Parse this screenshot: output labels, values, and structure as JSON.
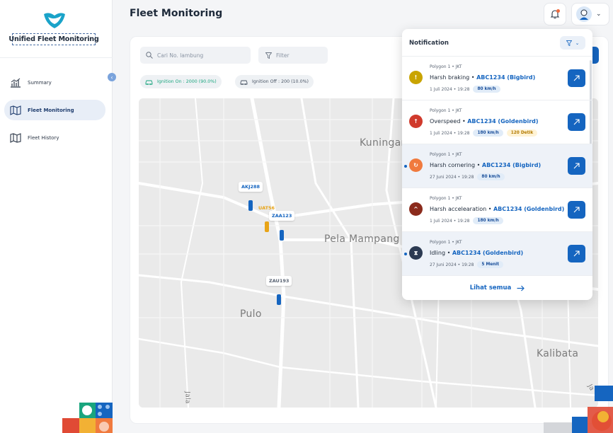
{
  "app": {
    "brand": "Unified Fleet Monitoring"
  },
  "sidebar": {
    "items": [
      {
        "label": "Summary",
        "icon": "chart-bar-icon",
        "active": false
      },
      {
        "label": "Fleet Monitoring",
        "icon": "map-icon",
        "active": true
      },
      {
        "label": "Fleet History",
        "icon": "map-icon",
        "active": false
      }
    ]
  },
  "header": {
    "title": "Fleet Monitoring"
  },
  "toolbar": {
    "search_placeholder": "Cari No. lambung",
    "filter_label": "Filter"
  },
  "status": {
    "ignition_on": "Ignition On : 2000 (90.0%)",
    "ignition_off": "Ignition Off : 200 (10.0%)"
  },
  "map": {
    "places": [
      "Kuningan",
      "Pela Mampang",
      "Pulo",
      "Kalibata",
      "Jala",
      "Ja"
    ],
    "vehicles": [
      {
        "plate": "AKJ288",
        "color": "#1565c0"
      },
      {
        "plate": "UAT56",
        "color": "#e8a417"
      },
      {
        "plate": "ZAA123",
        "color": "#1565c0"
      },
      {
        "plate": "ZAU193",
        "color": "#5a6473"
      }
    ]
  },
  "notifications": {
    "title": "Notification",
    "see_all": "Lihat semua",
    "items": [
      {
        "meta": "Polygon 1 • JKT",
        "event": "Harsh braking • ",
        "vehicle": "ABC1234  (Bigbird)",
        "date": "1 Juli 2024 • 19:28",
        "badges": [
          "80 km/h"
        ],
        "unread": false,
        "icon_color": "#c9a400",
        "icon": "!"
      },
      {
        "meta": "Polygon 1 • JKT",
        "event": "Overspeed • ",
        "vehicle": "ABC1234 (Goldenbird)",
        "date": "1 Juli 2024 • 19:28",
        "badges": [
          "180 km/h",
          "120 Detik"
        ],
        "unread": false,
        "icon_color": "#d03a2c",
        "icon": "↑"
      },
      {
        "meta": "Polygon 1 • JKT",
        "event": "Harsh cornering  • ",
        "vehicle": "ABC1234 (Bigbird)",
        "date": "27 Juni 2024 • 19:28",
        "badges": [
          "80 km/h"
        ],
        "unread": true,
        "icon_color": "#f07a3e",
        "icon": "↻"
      },
      {
        "meta": "Polygon 1 • JKT",
        "event": "Harsh accelearation • ",
        "vehicle": "ABC1234 (Goldenbird)",
        "date": "1 Juli 2024 • 19:28",
        "badges": [
          "180 km/h"
        ],
        "unread": false,
        "icon_color": "#8b2b1c",
        "icon": "^"
      },
      {
        "meta": "Polygon 1 • JKT",
        "event": "Idling • ",
        "vehicle": "ABC1234 (Goldenbird)",
        "date": "27 Juni 2024 • 19:28",
        "badges": [
          "5 Menit"
        ],
        "unread": true,
        "icon_color": "#2c3a52",
        "icon": "⧗"
      }
    ]
  }
}
